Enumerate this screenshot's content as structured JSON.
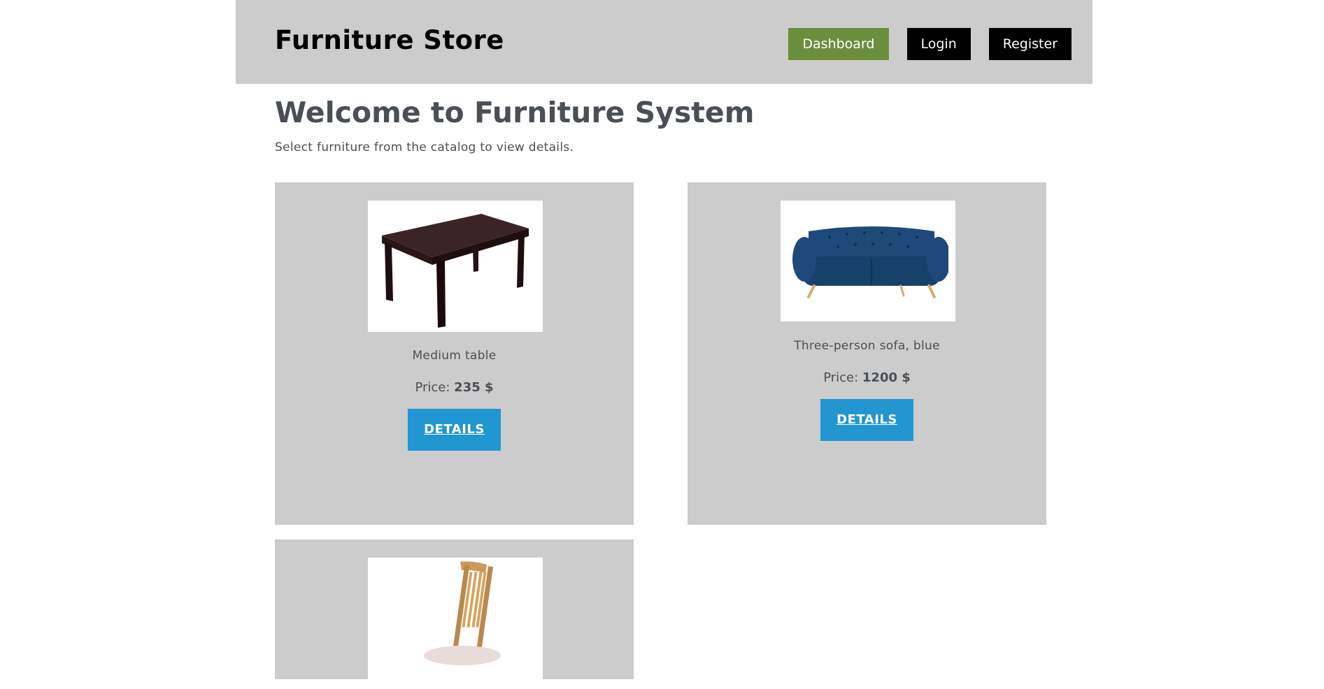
{
  "header": {
    "brand": "Furniture Store",
    "nav": {
      "dashboard": "Dashboard",
      "login": "Login",
      "register": "Register"
    }
  },
  "main": {
    "title": "Welcome to Furniture System",
    "subtitle": "Select furniture from the catalog to view details."
  },
  "catalog": {
    "price_label": "Price:",
    "details_label": "DETAILS",
    "items": [
      {
        "name": "Medium table",
        "price": "235 $",
        "image": "table-image"
      },
      {
        "name": "Three-person sofa, blue",
        "price": "1200 $",
        "image": "sofa-image"
      },
      {
        "name": "",
        "price": "",
        "image": "chair-image"
      }
    ]
  },
  "colors": {
    "header_bg": "#cccccc",
    "dashboard_button": "#6b8e3e",
    "nav_button": "#000000",
    "details_button": "#2196d0",
    "card_bg": "#cccccc"
  }
}
